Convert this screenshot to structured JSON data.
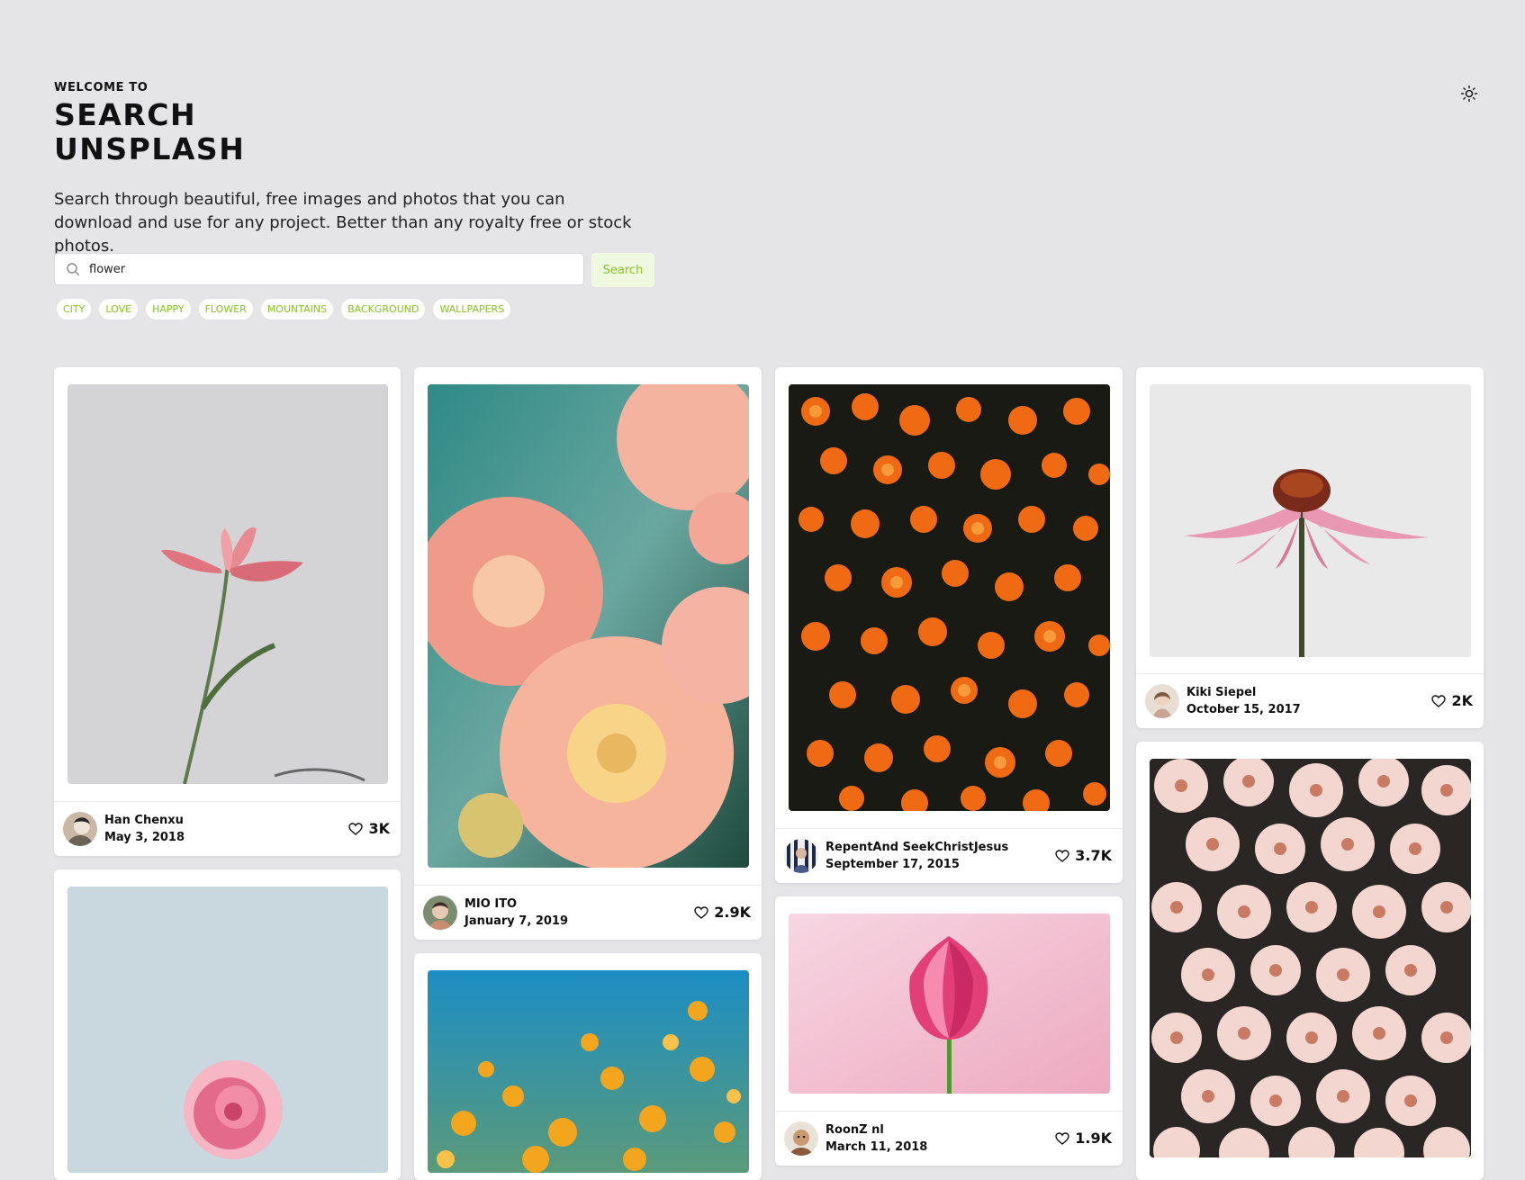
{
  "header": {
    "welcome": "WELCOME TO",
    "title_line1": "SEARCH",
    "title_line2": "UNSPLASH",
    "subtitle_line1": "Search through beautiful, free images and photos that you can",
    "subtitle_line2": "download and use for any project. Better than any royalty free or stock photos."
  },
  "search": {
    "value": "flower",
    "button_label": "Search"
  },
  "tags": [
    "CITY",
    "LOVE",
    "HAPPY",
    "FLOWER",
    "MOUNTAINS",
    "BACKGROUND",
    "WALLPAPERS"
  ],
  "theme_toggle": {
    "icon": "sun-icon"
  },
  "cards": [
    {
      "author": "Han Chenxu",
      "date": "May 3, 2018",
      "likes": "3K"
    },
    {
      "author": "MIO ITO",
      "date": "January 7, 2019",
      "likes": "2.9K"
    },
    {
      "author": "RepentAnd SeekChristJesus",
      "date": "September 17, 2015",
      "likes": "3.7K"
    },
    {
      "author": "Kiki Siepel",
      "date": "October 15, 2017",
      "likes": "2K"
    },
    {
      "author": "RoonZ nl",
      "date": "March 11, 2018",
      "likes": "1.9K"
    }
  ],
  "colors": {
    "accent": "#84c41f",
    "accent_bg": "#eef9df",
    "page_bg": "#e5e5e7"
  }
}
